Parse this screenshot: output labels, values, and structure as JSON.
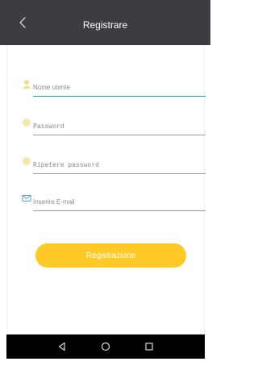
{
  "header": {
    "title": "Registrare",
    "back_icon": "chevron-left-icon",
    "background": "#3b3d41"
  },
  "form": {
    "username": {
      "placeholder": "Nome utente",
      "icon": "user-icon"
    },
    "password": {
      "placeholder": "Password",
      "icon": "lock-icon"
    },
    "confirm_password": {
      "placeholder": "Ripetere password",
      "icon": "lock-icon"
    },
    "email": {
      "placeholder": "Inserire E-mail",
      "icon": "mail-icon"
    },
    "submit_label": "Registrazione",
    "accent_color": "#ffca28",
    "focus_color": "#1fb3a3"
  },
  "navbar": {
    "back_icon": "triangle-back-icon",
    "home_icon": "circle-home-icon",
    "recents_icon": "square-recents-icon"
  }
}
